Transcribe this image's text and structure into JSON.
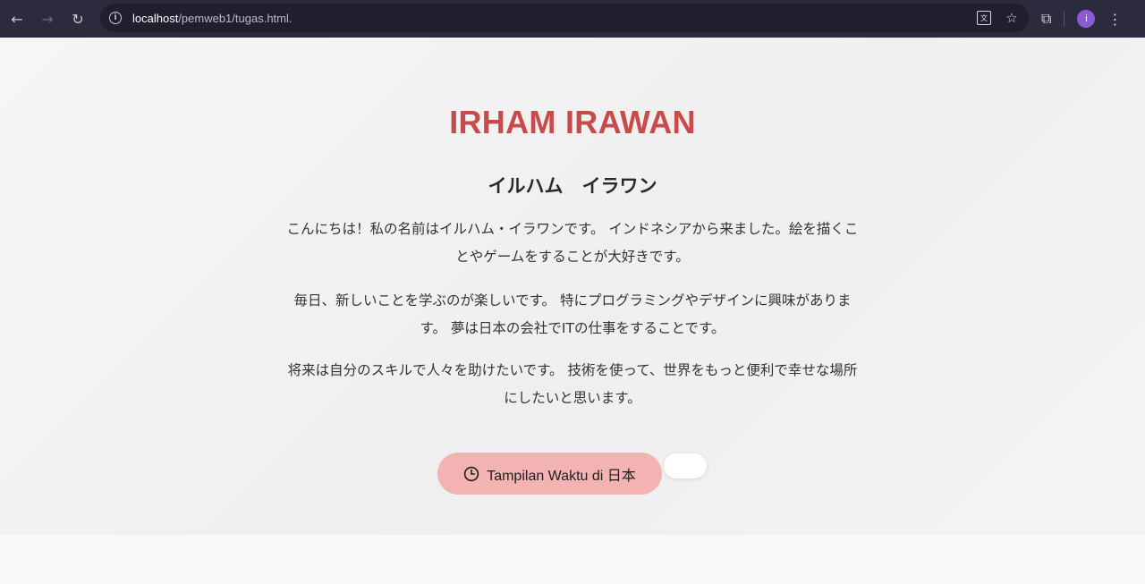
{
  "browser": {
    "url_host": "localhost",
    "url_path": "/pemweb1/tugas.html.",
    "avatar_letter": "i"
  },
  "page": {
    "title": "IRHAM IRAWAN",
    "subtitle": "イルハム　イラワン",
    "paragraphs": [
      "こんにちは！私の名前はイルハム・イラワンです。 インドネシアから来ました。絵を描くことやゲームをすることが大好きです。",
      "毎日、新しいことを学ぶのが楽しいです。 特にプログラミングやデザインに興味があります。 夢は日本の会社でITの仕事をすることです。",
      "将来は自分のスキルで人々を助けたいです。 技術を使って、世界をもっと便利で幸せな場所にしたいと思います。"
    ],
    "time_button_label": "Tampilan Waktu di 日本"
  },
  "colors": {
    "title": "#c84b4b",
    "button_bg": "#f4b3b3",
    "chrome_bg": "#2b2b3d",
    "avatar_bg": "#8e5bd6"
  },
  "icons": {
    "back": "arrow-left-icon",
    "forward": "arrow-right-icon",
    "reload": "reload-icon",
    "site_info": "info-icon",
    "translate": "translate-icon",
    "bookmark": "star-icon",
    "extensions": "puzzle-icon",
    "menu": "kebab-menu-icon",
    "clock": "clock-icon"
  }
}
